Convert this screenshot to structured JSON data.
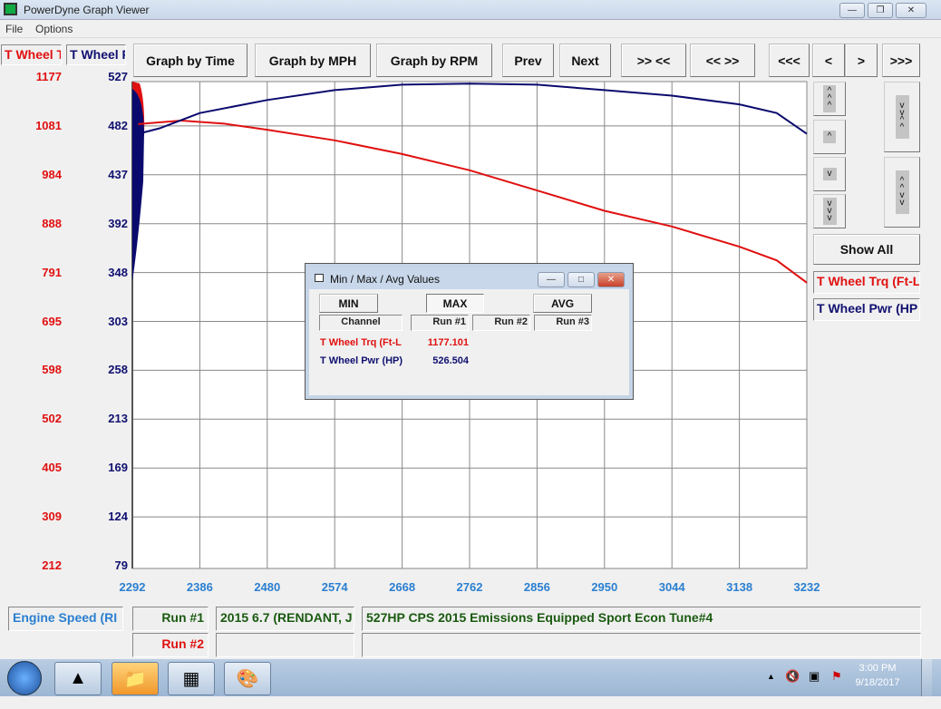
{
  "window": {
    "title": "PowerDyne Graph Viewer",
    "controls": [
      "minimize",
      "restore",
      "close"
    ]
  },
  "menu": [
    "File",
    "Options"
  ],
  "channel_tabs": [
    {
      "label": "T Wheel Trq (Ft-L",
      "color": "#e01010"
    },
    {
      "label": "T Wheel Pwr (HP",
      "color": "#101070"
    }
  ],
  "toolbar": [
    "Graph by Time",
    "Graph by MPH",
    "Graph by RPM",
    "Prev",
    "Next",
    ">> <<",
    "<< >>",
    "<<<",
    "<",
    ">",
    ">>>"
  ],
  "side": {
    "show_all": "Show All",
    "scroll_icons": [
      "triple-up",
      "up",
      "down",
      "triple-down"
    ],
    "zoom_icons": [
      "zoom-out-vertical",
      "zoom-in-vertical"
    ],
    "legend": [
      "T Wheel Trq (Ft-L",
      "T Wheel Pwr (HP"
    ]
  },
  "chart_data": {
    "type": "line",
    "xlabel": "Engine Speed (RI",
    "x_ticks": [
      "2292",
      "2386",
      "2480",
      "2574",
      "2668",
      "2762",
      "2856",
      "2950",
      "3044",
      "3138",
      "3232"
    ],
    "xlim": [
      2292,
      3232
    ],
    "y_left_ticks": [
      "1177",
      "1081",
      "984",
      "888",
      "791",
      "695",
      "598",
      "502",
      "405",
      "309",
      "212"
    ],
    "y_left_lim": [
      212,
      1177
    ],
    "y_right_ticks": [
      "527",
      "482",
      "437",
      "392",
      "348",
      "303",
      "258",
      "213",
      "169",
      "124",
      "79"
    ],
    "y_right_lim": [
      79,
      527
    ],
    "grid": true,
    "colors": {
      "torque": "#e01010",
      "power": "#0a0a6e"
    },
    "series": [
      {
        "name": "T Wheel Trq (Ft-L",
        "axis": "left",
        "x": [
          2300,
          2360,
          2420,
          2480,
          2574,
          2668,
          2762,
          2856,
          2950,
          3044,
          3138,
          3190,
          3232
        ],
        "y": [
          1084,
          1091,
          1085,
          1073,
          1052,
          1025,
          993,
          953,
          913,
          882,
          842,
          815,
          771
        ]
      },
      {
        "name": "T Wheel Pwr (HP",
        "axis": "right",
        "x": [
          2300,
          2330,
          2386,
          2480,
          2574,
          2668,
          2762,
          2856,
          2950,
          3044,
          3138,
          3190,
          3232
        ],
        "y": [
          475,
          480,
          494,
          506,
          515,
          520,
          521,
          520,
          515,
          510,
          502,
          494,
          475
        ]
      }
    ]
  },
  "dialog": {
    "title": "Min / Max / Avg Values",
    "buttons": [
      "MIN",
      "MAX",
      "AVG"
    ],
    "selected": "MAX",
    "headers": [
      "Channel",
      "Run #1",
      "Run #2",
      "Run #3"
    ],
    "rows": [
      {
        "channel": "T Wheel Trq (Ft-L",
        "run1": "1177.101",
        "color": "#e01010"
      },
      {
        "channel": "T Wheel Pwr (HP)",
        "run1": "526.504",
        "color": "#101070"
      }
    ]
  },
  "info": {
    "axis_channel": "Engine Speed (RI",
    "run1_label": "Run #1",
    "run1_vehicle": "2015 6.7 (RENDANT, J",
    "run1_desc": "527HP CPS 2015 Emissions Equipped Sport Econ Tune#4",
    "run2_label": "Run #2",
    "run2_vehicle": "",
    "run2_desc": ""
  },
  "taskbar": {
    "time": "3:00 PM",
    "date": "9/18/2017"
  }
}
